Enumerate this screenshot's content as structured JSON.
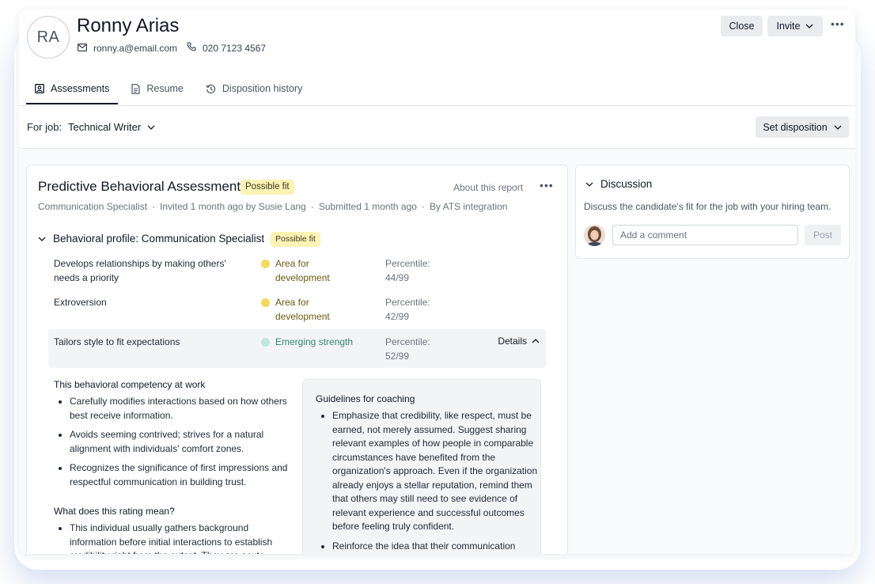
{
  "candidate": {
    "initials": "RA",
    "name": "Ronny Arias",
    "email": "ronny.a@email.com",
    "phone": "020 7123 4567"
  },
  "header_actions": {
    "close_label": "Close",
    "invite_label": "Invite",
    "more_icon": "ellipsis-icon"
  },
  "tabs": [
    {
      "label": "Assessments",
      "icon": "assessment-icon",
      "active": true
    },
    {
      "label": "Resume",
      "icon": "document-icon",
      "active": false
    },
    {
      "label": "Disposition history",
      "icon": "history-icon",
      "active": false
    }
  ],
  "job_bar": {
    "label": "For job:",
    "job": "Technical Writer",
    "set_disposition_label": "Set disposition"
  },
  "assessment": {
    "title": "Predictive Behavioral Assessment",
    "fit_badge": "Possible fit",
    "about_link": "About this report",
    "meta": {
      "role_link": "Communication Specialist",
      "invited": "Invited 1 month ago by Susie Lang",
      "submitted": "Submitted 1 month ago",
      "source": "By ATS integration"
    },
    "profile": {
      "title": "Behavioral profile: Communication Specialist",
      "badge": "Possible fit",
      "rows": [
        {
          "trait": "Develops relationships by making others' needs a priority",
          "rating": "Area for development",
          "percentile_label": "Percentile:",
          "percentile": "44/99",
          "dot_color": "#f5d95c"
        },
        {
          "trait": "Extroversion",
          "rating": "Area for development",
          "percentile_label": "Percentile:",
          "percentile": "42/99",
          "dot_color": "#f5d95c"
        },
        {
          "trait": "Tailors style to fit expectations",
          "rating": "Emerging strength",
          "percentile_label": "Percentile:",
          "percentile": "52/99",
          "dot_color": "#bfe8dc",
          "details_label": "Details"
        }
      ]
    },
    "competency": {
      "heading": "This behavioral competency at work",
      "bullets": [
        "Carefully modifies interactions based on how others best receive information.",
        "Avoids seeming contrived; strives for a natural alignment with individuals' comfort zones.",
        "Recognizes the significance of first impressions and respectful communication in building trust."
      ]
    },
    "rating_meaning": {
      "heading": "What does this rating mean?",
      "bullets": [
        "This individual usually gathers background information before initial interactions to establish credibility right from the outset. They are acute"
      ]
    },
    "coaching": {
      "heading": "Guidelines for coaching",
      "bullets": [
        "Emphasize that credibility, like respect, must be earned, not merely assumed. Suggest sharing relevant examples of how people in comparable circumstances have benefited from the organization's approach. Even if the organization already enjoys a stellar reputation, remind them that others may still need to see evidence of relevant experience and successful outcomes before feeling truly confident.",
        "Reinforce the idea that their communication"
      ]
    }
  },
  "discussion": {
    "title": "Discussion",
    "subtitle": "Discuss the candidate's fit for the job with your hiring team.",
    "comment_placeholder": "Add a comment",
    "post_label": "Post"
  },
  "colors": {
    "fit_badge_bg": "#fdf3b5",
    "development_text": "#6b5b10",
    "strength_text": "#2f8a6b",
    "accent_glow": "#7896d2"
  }
}
